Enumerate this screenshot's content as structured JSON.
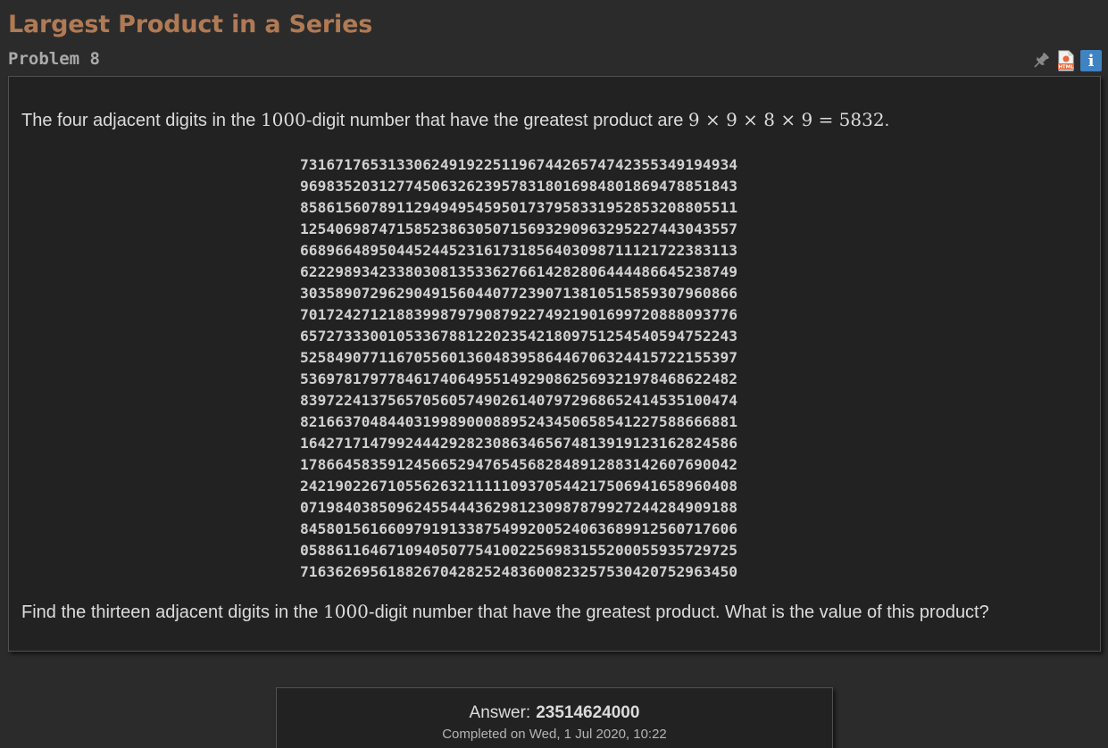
{
  "problem": {
    "title": "Largest Product in a Series",
    "number_label": "Problem 8"
  },
  "toolbar": {
    "icons": [
      "pin-icon",
      "html-file-icon",
      "info-icon"
    ],
    "info_glyph": "i",
    "html_badge": "HTML"
  },
  "statement": {
    "p1_before": "The four adjacent digits in the ",
    "p1_count": "1000",
    "p1_middle": "-digit number that have the greatest product are ",
    "p1_math": "9 × 9 × 8 × 9 = 5832",
    "p1_end": ".",
    "digits": [
      "73167176531330624919225119674426574742355349194934",
      "96983520312774506326239578318016984801869478851843",
      "85861560789112949495459501737958331952853208805511",
      "12540698747158523863050715693290963295227443043557",
      "66896648950445244523161731856403098711121722383113",
      "62229893423380308135336276614282806444486645238749",
      "30358907296290491560440772390713810515859307960866",
      "70172427121883998797908792274921901699720888093776",
      "65727333001053367881220235421809751254540594752243",
      "52584907711670556013604839586446706324415722155397",
      "53697817977846174064955149290862569321978468622482",
      "83972241375657056057490261407972968652414535100474",
      "82166370484403199890008895243450658541227588666881",
      "16427171479924442928230863465674813919123162824586",
      "17866458359124566529476545682848912883142607690042",
      "24219022671055626321111109370544217506941658960408",
      "07198403850962455444362981230987879927244284909188",
      "84580156166097919133875499200524063689912560717606",
      "05886116467109405077541002256983155200055935729725",
      "71636269561882670428252483600823257530420752963450"
    ],
    "p2_before": "Find the thirteen adjacent digits in the ",
    "p2_count": "1000",
    "p2_end": "-digit number that have the greatest product. What is the value of this product?"
  },
  "answer": {
    "label": "Answer:",
    "value": "23514624000",
    "completed": "Completed on Wed, 1 Jul 2020, 10:22"
  },
  "colors": {
    "background": "#2b2b2b",
    "panel": "#222222",
    "title": "#b07a55",
    "info_icon": "#3f83c2",
    "html_icon": "#e8673a"
  }
}
